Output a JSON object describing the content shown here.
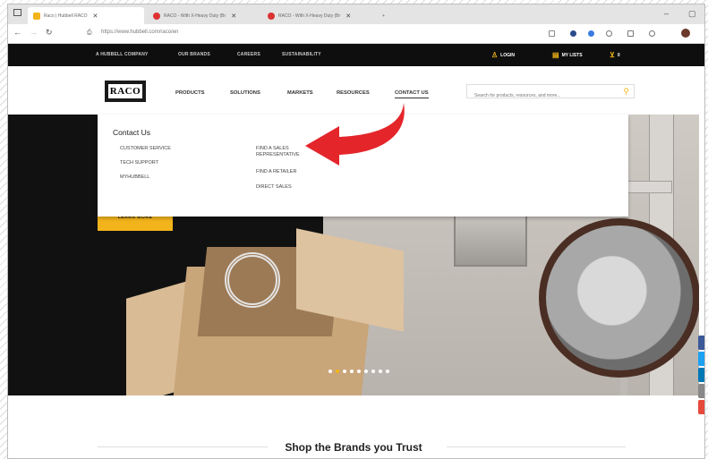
{
  "browser": {
    "tabs": [
      {
        "title": "Raco | Hubbell RACO",
        "active": true
      },
      {
        "title": "RACO - With X-Heavy Duty (Br",
        "active": false
      },
      {
        "title": "RACO - With X-Heavy Duty (Br",
        "active": false
      }
    ],
    "new_tab_label": "+",
    "url": "https://www.hubbell.com/raco/en"
  },
  "utility_nav": {
    "items": [
      "A HUBBELL COMPANY",
      "OUR BRANDS",
      "CAREERS",
      "SUSTAINABILITY"
    ],
    "login": "LOGIN",
    "my_lists": "MY LISTS",
    "cart_count": "0"
  },
  "main_nav": {
    "logo": "RACO",
    "items": [
      "PRODUCTS",
      "SOLUTIONS",
      "MARKETS",
      "RESOURCES",
      "CONTACT US"
    ],
    "search_placeholder": "Search for products, resources, and more..."
  },
  "dropdown": {
    "heading": "Contact Us",
    "col1": [
      "CUSTOMER SERVICE",
      "TECH SUPPORT",
      "MYHUBBELL"
    ],
    "col2": [
      "FIND A SALES REPRESENTATIVE",
      "FIND A RETAILER",
      "DIRECT SALES"
    ]
  },
  "hero": {
    "cta": "LEARN MORE",
    "slide_count": 9,
    "active_slide": 2
  },
  "colors": {
    "accent": "#f3b41b",
    "arrow": "#e4262b",
    "topbar": "#0e0e0e"
  },
  "section_title": "Shop the Brands you Trust",
  "social": [
    "facebook",
    "twitter",
    "linkedin",
    "email",
    "share"
  ]
}
